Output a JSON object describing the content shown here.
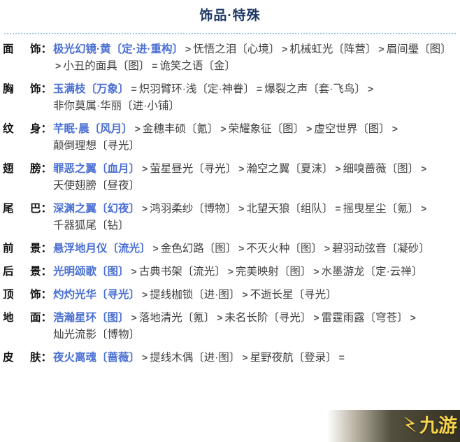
{
  "header": {
    "title": "饰品·特殊"
  },
  "separator": ">",
  "rows": [
    {
      "label_left": "面",
      "label_right": "饰",
      "colon": "：",
      "items": [
        {
          "text": "极光幻镜·黄〔定·进·重构〕",
          "sep_after": ">"
        },
        {
          "text": "怃悟之泪〔心境〕",
          "sep_after": ">"
        },
        {
          "text": "机械虹光〔阵营〕",
          "sep_after": ">"
        },
        {
          "text": "眉间璺〔图〕",
          "sep_after": ">"
        },
        {
          "text": "小丑的面具〔图〕",
          "sep_after": "="
        },
        {
          "text": "诡笑之语〔金〕",
          "sep_after": ""
        }
      ]
    },
    {
      "label_left": "胸",
      "label_right": "饰",
      "colon": "：",
      "items": [
        {
          "text": "玉满枝〔万象〕",
          "sep_after": "="
        },
        {
          "text": "炽羽臂环·浅〔定·神眷〕",
          "sep_after": "="
        },
        {
          "text": "爆裂之声〔套·飞鸟〕",
          "sep_after": ">"
        },
        {
          "text": "非你莫属·华丽〔进·小铺〕",
          "sep_after": ""
        }
      ]
    },
    {
      "label_left": "纹",
      "label_right": "身",
      "colon": "：",
      "items": [
        {
          "text": "芊眠·晨〔风月〕",
          "sep_after": ">"
        },
        {
          "text": "金穗丰硕〔氪〕",
          "sep_after": ">"
        },
        {
          "text": "荣耀象征〔图〕",
          "sep_after": ">"
        },
        {
          "text": "虚空世界〔图〕",
          "sep_after": ">"
        },
        {
          "text": "颠倒理想〔寻光〕",
          "sep_after": ""
        }
      ]
    },
    {
      "label_left": "翅",
      "label_right": "膀",
      "colon": "：",
      "items": [
        {
          "text": "罪恶之翼〔血月〕",
          "sep_after": ">"
        },
        {
          "text": "萤星昼光〔寻光〕",
          "sep_after": ">"
        },
        {
          "text": "瀚空之翼〔夏沫〕",
          "sep_after": ">"
        },
        {
          "text": "细嗅蔷薇〔图〕",
          "sep_after": ">"
        },
        {
          "text": "天使翅膀〔昼夜〕",
          "sep_after": ""
        }
      ]
    },
    {
      "label_left": "尾",
      "label_right": "巴",
      "colon": "：",
      "items": [
        {
          "text": "深渊之翼〔幻夜〕",
          "sep_after": ">"
        },
        {
          "text": "鸿羽柔纱〔博物〕",
          "sep_after": ">"
        },
        {
          "text": "北望天狼〔组队〕",
          "sep_after": "="
        },
        {
          "text": "摇曳星尘〔氪〕",
          "sep_after": ">"
        },
        {
          "text": "千器狐尾〔钻〕",
          "sep_after": ""
        }
      ]
    },
    {
      "label_left": "前",
      "label_right": "景",
      "colon": "：",
      "items": [
        {
          "text": "悬浮地月仪〔流光〕",
          "sep_after": ">"
        },
        {
          "text": "金色幻路〔图〕",
          "sep_after": ">"
        },
        {
          "text": "不灭火种〔图〕",
          "sep_after": ">"
        },
        {
          "text": "碧羽动弦音〔凝砂〕",
          "sep_after": ""
        }
      ]
    },
    {
      "label_left": "后",
      "label_right": "景",
      "colon": "：",
      "items": [
        {
          "text": "光明颂歌〔图〕",
          "sep_after": ">"
        },
        {
          "text": "古典书架〔流光〕",
          "sep_after": ">"
        },
        {
          "text": "完美映射〔图〕",
          "sep_after": ">"
        },
        {
          "text": "水墨游龙〔定·云禅〕",
          "sep_after": ""
        }
      ]
    },
    {
      "label_left": "顶",
      "label_right": "饰",
      "colon": "：",
      "items": [
        {
          "text": "灼灼光华〔寻光〕",
          "sep_after": ">"
        },
        {
          "text": "提线枷锁〔进·图〕",
          "sep_after": ">"
        },
        {
          "text": "不逝长星〔寻光〕",
          "sep_after": ""
        }
      ]
    },
    {
      "label_left": "地",
      "label_right": "面",
      "colon": "：",
      "items": [
        {
          "text": "浩瀚星环〔图〕",
          "sep_after": ">"
        },
        {
          "text": "落地清光〔氪〕",
          "sep_after": ">"
        },
        {
          "text": "未名长阶〔寻光〕",
          "sep_after": ">"
        },
        {
          "text": "雷霆雨露〔穹苍〕",
          "sep_after": ">"
        },
        {
          "text": "灿光流影〔博物〕",
          "sep_after": ""
        }
      ]
    },
    {
      "label_left": "皮",
      "label_right": "肤",
      "colon": "：",
      "items": [
        {
          "text": "夜火离魂〔蔷薇〕",
          "sep_after": ">"
        },
        {
          "text": "提线木偶〔进·图〕",
          "sep_after": ">"
        },
        {
          "text": "星野夜航〔登录〕",
          "sep_after": "="
        }
      ]
    }
  ],
  "watermark": {
    "bolt": "⚡",
    "text": "九游"
  },
  "colors": {
    "title": "#1f3864",
    "divider": "#8fc7e8",
    "first_item": "#4a6fd4",
    "rest_item": "#3f3f3f",
    "watermark": "#f5d34a"
  }
}
